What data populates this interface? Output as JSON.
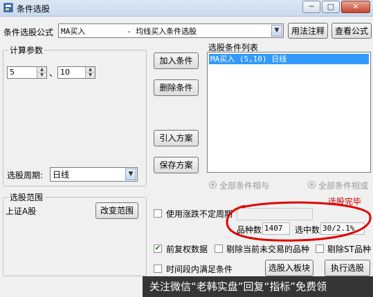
{
  "window": {
    "title": "条件选股",
    "minimize": "─",
    "maximize": "□",
    "close": "✕"
  },
  "formula": {
    "label": "条件选股公式",
    "value": "MA买入         - 均线买入条件选股"
  },
  "buttons": {
    "usage_notes": "用法注释",
    "view_formula": "查看公式",
    "add_condition": "加入条件",
    "delete_condition": "删除条件",
    "import_plan": "引入方案",
    "save_plan": "保存方案",
    "change_range": "改变范围",
    "select_to_block": "选股入板块",
    "execute": "执行选股"
  },
  "params": {
    "group_title": "计算参数",
    "param1": "5",
    "separator": "、",
    "param2": "10"
  },
  "period": {
    "label": "选股周期:",
    "value": "日线"
  },
  "condition_list": {
    "title": "选股条件列表",
    "items": [
      "MA买入 (5,10) 日线"
    ]
  },
  "logic": {
    "all_and": "全部条件相与",
    "all_or": "全部条件相或"
  },
  "range": {
    "group_title": "选股范围",
    "value": "上证A股"
  },
  "options": {
    "use_unstable_period": "使用涨跌不定周期",
    "forward_adjust": "前复权数据",
    "exclude_untraded": "剔除当前未交易的品种",
    "exclude_st": "剔除ST品种",
    "time_range": "时间段内满足条件"
  },
  "stats": {
    "count_label": "品种数",
    "count_value": "1407",
    "selected_label": "选中数",
    "selected_value": "30/2.1%"
  },
  "status": "选股完毕",
  "watermark": "关注微信“老韩实盘”回复“指标”免费领",
  "colors": {
    "selection": "#3399ff",
    "annotation_ellipse": "#e00000",
    "status": "#d00000"
  }
}
